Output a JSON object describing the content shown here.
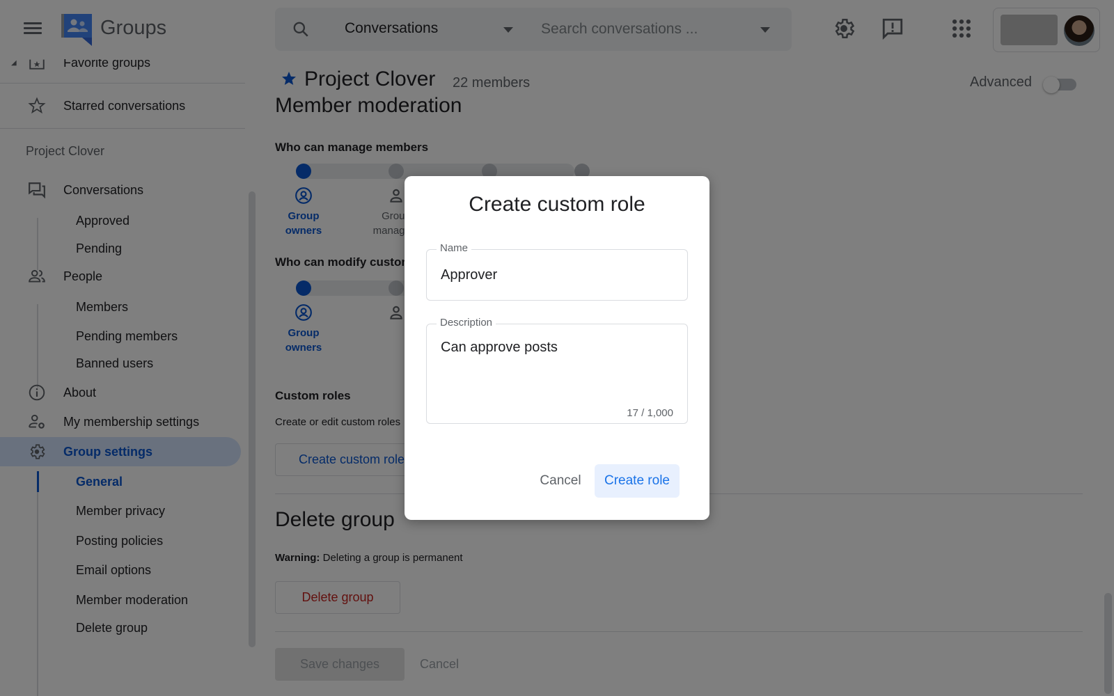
{
  "header": {
    "app_name": "Groups",
    "search_scope": "Conversations",
    "search_placeholder": "Search conversations ...",
    "search_value": ""
  },
  "sidebar": {
    "favorite_groups": "Favorite groups",
    "starred": "Starred conversations",
    "group_section": "Project Clover",
    "conversations": {
      "label": "Conversations",
      "children": [
        "Approved",
        "Pending"
      ]
    },
    "people": {
      "label": "People",
      "children": [
        "Members",
        "Pending members",
        "Banned users"
      ]
    },
    "about": "About",
    "membership_settings": "My membership settings",
    "group_settings": {
      "label": "Group settings",
      "active_child": "General",
      "children": [
        "General",
        "Member privacy",
        "Posting policies",
        "Email options",
        "Member moderation",
        "Delete group"
      ]
    }
  },
  "main": {
    "group_name": "Project Clover",
    "member_count": "22 members",
    "advanced_label": "Advanced",
    "advanced_enabled": false,
    "section_title": "Member moderation",
    "manage_members": {
      "label": "Who can manage members",
      "options": [
        "Group owners",
        "Group managers"
      ],
      "selected_index": 0,
      "steps": 4
    },
    "modify_custom_roles": {
      "label": "Who can modify custom roles",
      "options": [
        "Group owners",
        ""
      ],
      "selected_index": 0,
      "steps": 4
    },
    "custom_roles": {
      "title": "Custom roles",
      "description": "Create or edit custom roles",
      "button": "Create custom role"
    },
    "delete_group": {
      "title": "Delete group",
      "warning_bold": "Warning:",
      "warning_text": "Deleting a group is permanent",
      "button": "Delete group"
    },
    "save_button": "Save changes",
    "cancel_button": "Cancel"
  },
  "dialog": {
    "title": "Create custom role",
    "name_label": "Name",
    "name_value": "Approver",
    "description_label": "Description",
    "description_value": "Can approve posts",
    "char_counter": "17 / 1,000",
    "cancel_button": "Cancel",
    "create_button": "Create role"
  },
  "colors": {
    "accent": "#0b57d0",
    "danger": "#c5221f",
    "link": "#1a73e8"
  }
}
